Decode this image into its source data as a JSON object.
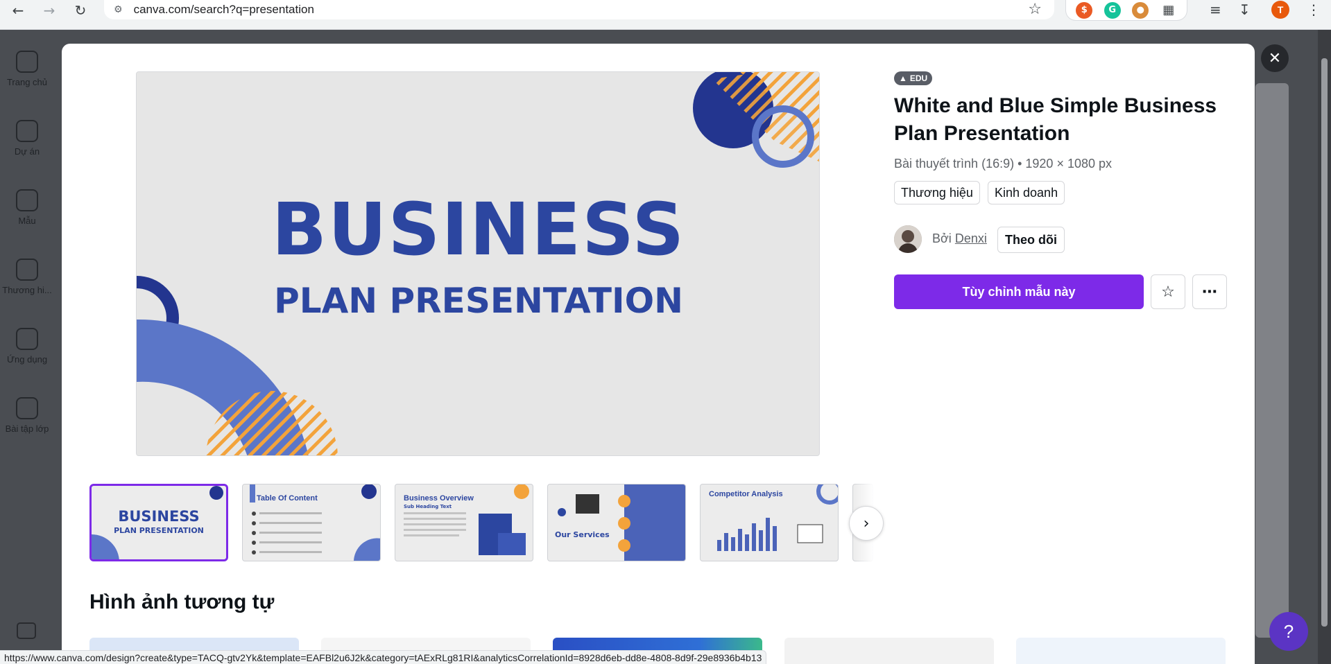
{
  "browser": {
    "url": "canva.com/search?q=presentation",
    "status_url": "https://www.canva.com/design?create&type=TACQ-gtv2Yk&template=EAFBl2u6J2k&category=tAExRLg81RI&analyticsCorrelationId=8928d6eb-dd8e-4808-8d9f-29e8936b4b13",
    "profile_initial": "T",
    "extensions": [
      "honey-extension",
      "grammarly-extension",
      "cookie-extension",
      "extensions-puzzle"
    ]
  },
  "sidebar": {
    "items": [
      {
        "label": "Trang chủ",
        "icon": "home-icon"
      },
      {
        "label": "Dự án",
        "icon": "folder-icon"
      },
      {
        "label": "Mẫu",
        "icon": "templates-icon"
      },
      {
        "label": "Thương hi...",
        "icon": "brand-icon"
      },
      {
        "label": "Ứng dụng",
        "icon": "apps-icon"
      },
      {
        "label": "Bài tập lớp",
        "icon": "assignments-icon"
      }
    ]
  },
  "modal": {
    "badge": "EDU",
    "title": "White and Blue Simple Business Plan Presentation",
    "meta": "Bài thuyết trình (16:9) • 1920 × 1080 px",
    "tags": [
      "Thương hiệu",
      "Kinh doanh"
    ],
    "author_prefix": "Bởi",
    "author_name": "Denxi",
    "follow_label": "Theo dõi",
    "cta_label": "Tùy chỉnh mẫu này",
    "similar_heading": "Hình ảnh tương tự"
  },
  "preview": {
    "title": "BUSINESS",
    "subtitle": "PLAN PRESENTATION"
  },
  "thumbnails": [
    {
      "title": "BUSINESS",
      "subtitle": "PLAN PRESENTATION"
    },
    {
      "title": "Table Of Content"
    },
    {
      "title": "Business Overview",
      "subtitle": "Sub Heading Text"
    },
    {
      "title": "Our Services"
    },
    {
      "title": "Competitor Analysis"
    }
  ],
  "colors": {
    "brand_purple": "#7d2ae8",
    "template_blue": "#2c46a0",
    "template_accent": "#f3a33b"
  }
}
